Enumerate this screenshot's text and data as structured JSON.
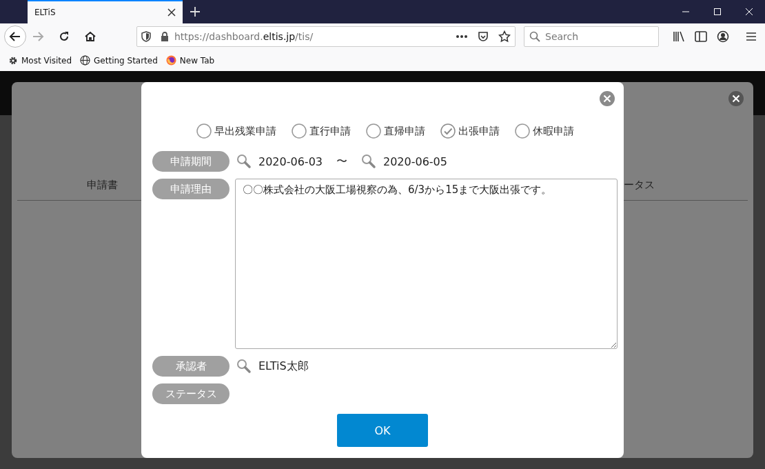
{
  "browser": {
    "tab": {
      "title": "ELTiS",
      "selected": true
    },
    "url": {
      "prefix": "https://dashboard.",
      "domain": "eltis.jp",
      "path": "/tis/"
    },
    "search": {
      "placeholder": "Search"
    },
    "bookmarks": [
      {
        "label": "Most Visited",
        "kind": "gear"
      },
      {
        "label": "Getting Started",
        "kind": "globe"
      },
      {
        "label": "New Tab",
        "kind": "firefox"
      }
    ]
  },
  "background_dialog": {
    "columns": [
      "申請書",
      "ータス"
    ]
  },
  "dialog": {
    "types": [
      {
        "label": "早出残業申請",
        "selected": false
      },
      {
        "label": "直行申請",
        "selected": false
      },
      {
        "label": "直帰申請",
        "selected": false
      },
      {
        "label": "出張申請",
        "selected": true
      },
      {
        "label": "休暇申請",
        "selected": false
      }
    ],
    "period": {
      "label": "申請期間",
      "from": "2020-06-03",
      "separator": "〜",
      "to": "2020-06-05"
    },
    "reason": {
      "label": "申請理由",
      "value": "〇〇株式会社の大阪工場視察の為、6/3から15まで大阪出張です。"
    },
    "approver": {
      "label": "承認者",
      "value": "ELTiS太郎"
    },
    "status": {
      "label": "ステータス"
    },
    "ok_button": "OK"
  }
}
